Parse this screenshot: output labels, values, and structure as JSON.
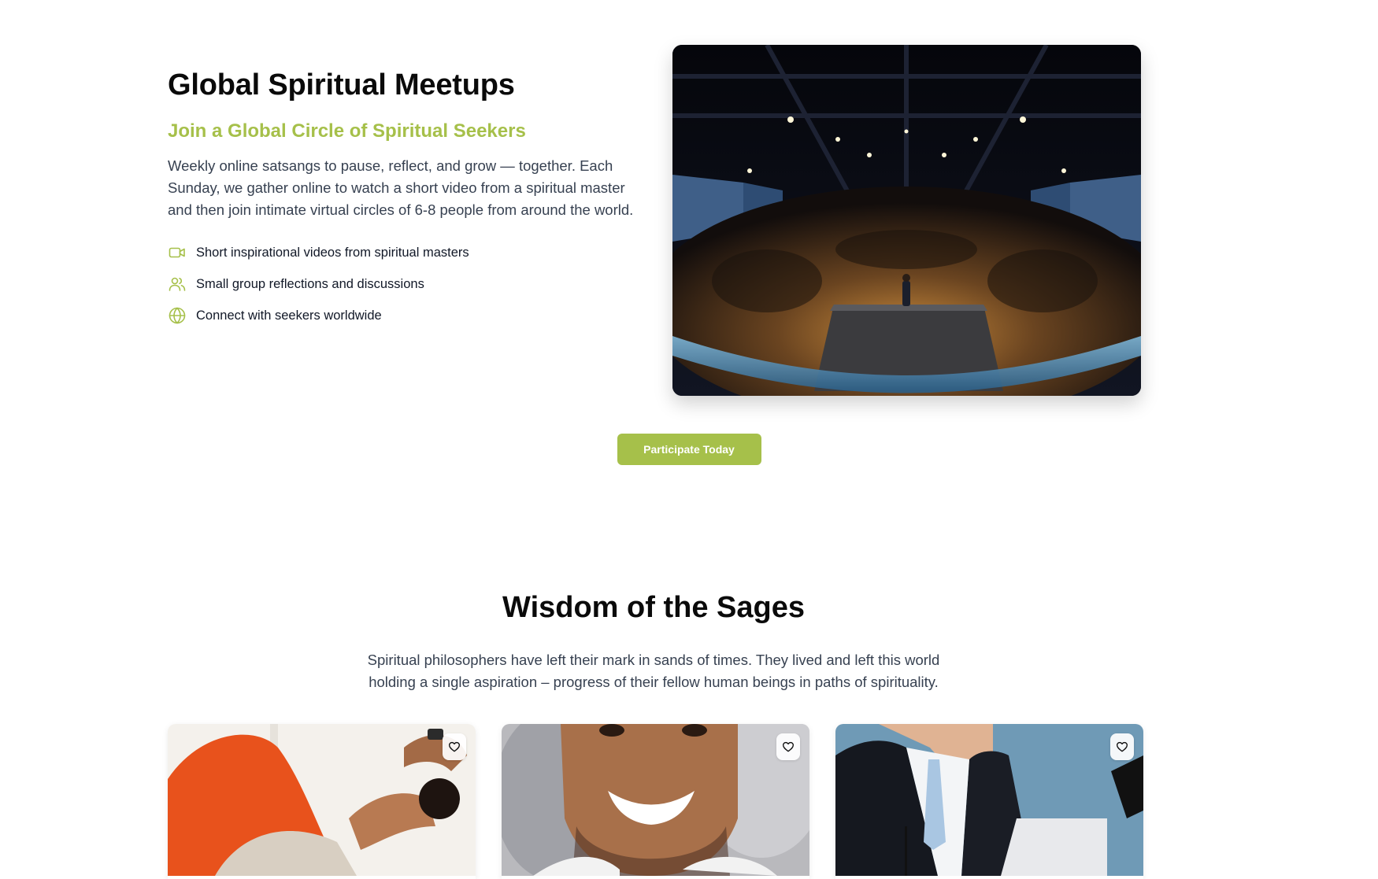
{
  "meetups": {
    "title": "Global Spiritual Meetups",
    "subtitle": "Join a Global Circle of Spiritual Seekers",
    "description": "Weekly online satsangs to pause, reflect, and grow — together. Each Sunday, we gather online to watch a short video from a spiritual master and then join intimate virtual circles of 6-8 people from around the world.",
    "features": [
      {
        "icon": "video-icon",
        "label": "Short inspirational videos from spiritual masters"
      },
      {
        "icon": "users-icon",
        "label": "Small group reflections and discussions"
      },
      {
        "icon": "globe-icon",
        "label": "Connect with seekers worldwide"
      }
    ],
    "image_alt": "Speaker on stage in a crowded auditorium",
    "cta_label": "Participate Today"
  },
  "sages": {
    "title": "Wisdom of the Sages",
    "description": "Spiritual philosophers have left their mark in sands of times. They lived and left this world holding a single aspiration – progress of their fellow human beings in paths of spirituality.",
    "cards": [
      {
        "image": "woman-exercising-photo",
        "favorite_icon": "heart-icon"
      },
      {
        "image": "smiling-man-photo",
        "favorite_icon": "heart-icon"
      },
      {
        "image": "man-in-suit-photo",
        "favorite_icon": "heart-icon"
      }
    ]
  },
  "colors": {
    "accent": "#a6c04a",
    "heading": "#0a0a0a",
    "body_text": "#374151"
  }
}
